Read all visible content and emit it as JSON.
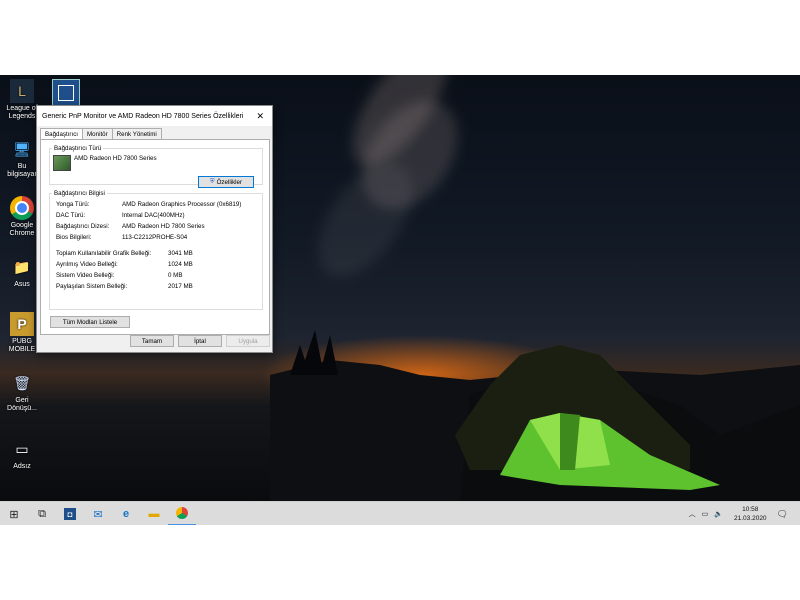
{
  "desktop": {
    "icons": [
      {
        "label": "League of Legends",
        "glyph": "L",
        "icon": "league-icon"
      },
      {
        "label": "Bu bilgisayar",
        "glyph": "🖥",
        "icon": "computer-icon"
      },
      {
        "label": "Google Chrome",
        "glyph": "◉",
        "icon": "chrome-icon"
      },
      {
        "label": "Asus",
        "glyph": "📁",
        "icon": "folder-icon"
      },
      {
        "label": "PUBG MOBILE",
        "glyph": "P",
        "icon": "pubg-icon"
      },
      {
        "label": "Geri Dönüşü...",
        "glyph": "🗑",
        "icon": "recycle-bin-icon"
      },
      {
        "label": "Adsız",
        "glyph": "▭",
        "icon": "document-icon"
      }
    ]
  },
  "dialog": {
    "title": "Generic PnP Monitor ve AMD Radeon HD 7800 Series Özellikleri",
    "tabs": [
      "Bağdaştırıcı",
      "Monitör",
      "Renk Yönetimi"
    ],
    "adapter_type_legend": "Bağdaştırıcı Türü",
    "adapter_name": "AMD Radeon HD 7800 Series",
    "properties_button": "Özellikler",
    "adapter_info_legend": "Bağdaştırıcı Bilgisi",
    "info": [
      {
        "label": "Yonga Türü:",
        "value": "AMD Radeon Graphics Processor (0x6819)"
      },
      {
        "label": "DAC Türü:",
        "value": "Internal DAC(400MHz)"
      },
      {
        "label": "Bağdaştırıcı Dizesi:",
        "value": "AMD Radeon HD 7800 Series"
      },
      {
        "label": "Bios Bilgileri:",
        "value": "113-C2212PROHE-S04"
      }
    ],
    "memory": [
      {
        "label": "Toplam Kullanılabilir Grafik Belleği:",
        "value": "3041 MB"
      },
      {
        "label": "Ayrılmış Video Belleği:",
        "value": "1024 MB"
      },
      {
        "label": "Sistem Video Belleği:",
        "value": "0 MB"
      },
      {
        "label": "Paylaşılan Sistem Belleği:",
        "value": "2017 MB"
      }
    ],
    "list_modes_button": "Tüm Modları Listele",
    "ok_button": "Tamam",
    "cancel_button": "İptal",
    "apply_button": "Uygula"
  },
  "taskbar": {
    "clock_time": "10:58",
    "clock_date": "21.03.2020"
  }
}
